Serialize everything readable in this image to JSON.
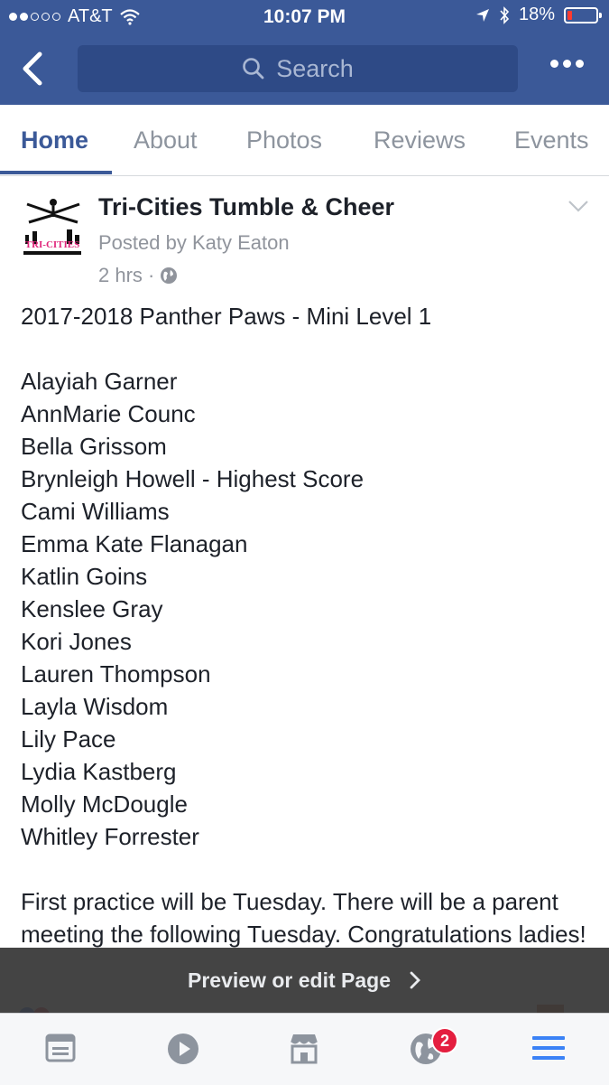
{
  "status_bar": {
    "carrier": "AT&T",
    "time": "10:07 PM",
    "battery": "18%",
    "battery_level": 0.18
  },
  "nav": {
    "search_placeholder": "Search"
  },
  "tabs": [
    {
      "label": "Home",
      "active": true
    },
    {
      "label": "About",
      "active": false
    },
    {
      "label": "Photos",
      "active": false
    },
    {
      "label": "Reviews",
      "active": false
    },
    {
      "label": "Events",
      "active": false
    }
  ],
  "post": {
    "page_name": "Tri-Cities Tumble & Cheer",
    "logo_text": "TRI-CITIES",
    "posted_by": "Posted by Katy Eaton",
    "time": "2 hrs ·",
    "title": "2017-2018 Panther Paws - Mini Level 1",
    "names": [
      "Alayiah Garner",
      "AnnMarie Counc",
      "Bella Grissom",
      "Brynleigh Howell - Highest Score",
      "Cami Williams",
      "Emma Kate Flanagan",
      "Katlin Goins",
      "Kenslee Gray",
      "Kori Jones",
      "Lauren Thompson",
      "Layla Wisdom",
      "Lily Pace",
      "Lydia Kastberg",
      "Molly McDougle",
      "Whitley Forrester"
    ],
    "closing": "First practice will be Tuesday. There will be a parent meeting the following Tuesday. Congratulations ladies!"
  },
  "preview_bar": {
    "label": "Preview or edit Page"
  },
  "tab_bar": {
    "notifications_badge": "2"
  },
  "colors": {
    "brand": "#3b5998",
    "badge": "#e41e3f",
    "text": "#1d2129",
    "muted": "#90949c"
  }
}
